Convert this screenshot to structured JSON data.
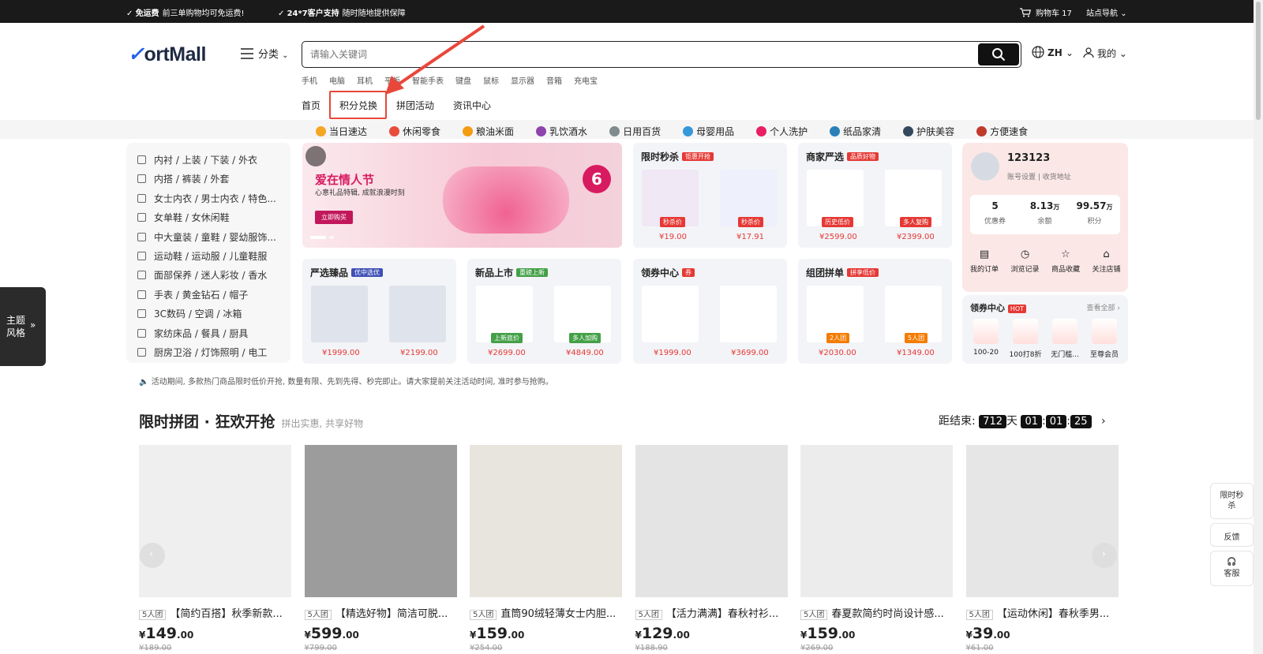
{
  "topbar": {
    "free_ship_title": "免运费",
    "free_ship_desc": "前三单购物均可免运费!",
    "support_title": "24*7客户支持",
    "support_desc": "随时随地提供保障",
    "cart": "购物车 17",
    "site_nav": "站点导航"
  },
  "header": {
    "logo": "ortMall",
    "category": "分类",
    "search_placeholder": "请输入关键词",
    "lang": "ZH",
    "mine": "我的"
  },
  "hot_keywords": [
    "手机",
    "电脑",
    "耳机",
    "平板",
    "智能手表",
    "键盘",
    "鼠标",
    "显示器",
    "音箱",
    "充电宝"
  ],
  "nav_links": [
    "首页",
    "积分兑换",
    "拼团活动",
    "资讯中心"
  ],
  "shelves": [
    "当日速达",
    "休闲零食",
    "粮油米面",
    "乳饮酒水",
    "日用百货",
    "母婴用品",
    "个人洗护",
    "纸品家清",
    "护肤美容",
    "方便速食"
  ],
  "left_categories": [
    "内衬 / 上装 / 下装 / 外衣",
    "内搭 / 裤装 / 外套",
    "女士内衣 / 男士内衣 / 特色...",
    "女单鞋 / 女休闲鞋",
    "中大童装 / 童鞋 / 婴幼服饰...",
    "运动鞋 / 运动服 / 儿童鞋服",
    "面部保养 / 迷人彩妆 / 香水",
    "手表 / 黄金钻石 / 帽子",
    "3C数码 / 空调 / 冰箱",
    "家纺床品 / 餐具 / 厨具",
    "厨房卫浴 / 灯饰照明 / 电工"
  ],
  "theme": {
    "line1": "主题",
    "line2": "风格"
  },
  "banner": {
    "title": "爱在情人节",
    "subtitle": "心意礼品特辑, 成就浪漫时刻",
    "cta": "立即购买",
    "badge": "6"
  },
  "tiles": {
    "flash": {
      "title": "限时秒杀",
      "tag": "钜惠开抢",
      "label1": "秒杀价",
      "label2": "秒杀价",
      "p1": "¥19.00",
      "p2": "¥17.91"
    },
    "select": {
      "title": "商家严选",
      "tag": "品质好物",
      "label1": "历史低价",
      "label2": "多人复购",
      "p1": "¥2599.00",
      "p2": "¥2399.00"
    },
    "premium": {
      "title": "严选臻品",
      "tag": "优中选优",
      "p1": "¥1999.00",
      "p2": "¥2199.00"
    },
    "new": {
      "title": "新品上市",
      "tag": "重磅上新",
      "label1": "上新底价",
      "label2": "多人加购",
      "p1": "¥2699.00",
      "p2": "¥4849.00"
    },
    "couponc": {
      "title": "领券中心",
      "tag": "券",
      "p1": "¥1999.00",
      "p2": "¥3699.00"
    },
    "group": {
      "title": "组团拼单",
      "tag": "拼享低价",
      "label1": "2人团",
      "label2": "5人团",
      "p1": "¥2030.00",
      "p2": "¥1349.00"
    }
  },
  "user": {
    "name": "123123",
    "settings": "账号设置",
    "address": "收货地址",
    "stats": [
      {
        "value": "5",
        "unit": "",
        "label": "优惠券"
      },
      {
        "value": "8.13",
        "unit": "万",
        "label": "余额"
      },
      {
        "value": "99.57",
        "unit": "万",
        "label": "积分"
      }
    ],
    "actions": [
      "我的订单",
      "浏览记录",
      "商品收藏",
      "关注店铺"
    ]
  },
  "coupon_center": {
    "title": "领券中心",
    "hot": "HOT",
    "more": "查看全部 ›",
    "items": [
      "100-20",
      "100打8折",
      "无门槛...",
      "至尊会员"
    ]
  },
  "notice": "活动期间, 多款热门商品限时低价开抢, 数量有限、先到先得、秒完即止。请大家提前关注活动时间, 准时参与抢购。",
  "section": {
    "title": "限时拼团 · 狂欢开抢",
    "subtitle": "拼出实惠, 共享好物"
  },
  "countdown": {
    "label": "距结束:",
    "days": "712",
    "day_unit": "天",
    "hours": "01",
    "minutes": "01",
    "seconds": "25"
  },
  "products": [
    {
      "tag": "5人团",
      "title": "【简约百搭】秋季新款...",
      "price": "149",
      "dec": ".00",
      "orig": "¥189.00"
    },
    {
      "tag": "5人团",
      "title": "【精选好物】简洁可脱...",
      "price": "599",
      "dec": ".00",
      "orig": "¥799.00"
    },
    {
      "tag": "5人团",
      "title": "直筒90绒轻薄女士内胆...",
      "price": "159",
      "dec": ".00",
      "orig": "¥254.00"
    },
    {
      "tag": "5人团",
      "title": "【活力满满】春秋衬衫...",
      "price": "129",
      "dec": ".00",
      "orig": "¥188.90"
    },
    {
      "tag": "5人团",
      "title": "春夏款简约时尚设计感...",
      "price": "159",
      "dec": ".00",
      "orig": "¥269.00"
    },
    {
      "tag": "5人团",
      "title": "【运动休闲】春秋季男...",
      "price": "39",
      "dec": ".00",
      "orig": "¥61.00"
    }
  ],
  "currency": "¥",
  "sidebar": {
    "flash": "限时秒杀",
    "feedback": "反馈",
    "service": "客服"
  }
}
